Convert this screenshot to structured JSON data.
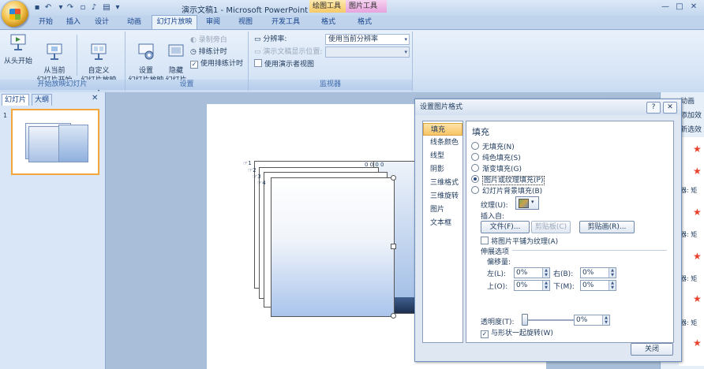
{
  "window": {
    "title": "演示文稿1 - Microsoft PowerPoint",
    "context_tabs": [
      "绘图工具",
      "图片工具"
    ],
    "controls": [
      "—",
      "□",
      "✕"
    ]
  },
  "ribbon_tabs": [
    "开始",
    "插入",
    "设计",
    "动画",
    "幻灯片放映",
    "审阅",
    "视图",
    "开发工具",
    "格式",
    "格式"
  ],
  "active_tab": "幻灯片放映",
  "ribbon": {
    "group_start": {
      "label": "开始放映幻灯片",
      "btn_from_start": "从头开始",
      "btn_from_current": "从当前\n幻灯片开始",
      "btn_custom": "自定义\n幻灯片放映 ▾"
    },
    "group_setup": {
      "label": "设置",
      "btn_setup": "设置\n幻灯片放映",
      "btn_hide": "隐藏\n幻灯片",
      "record_narration": "录制旁白",
      "rehearse_timings": "排练计时",
      "use_timings": "使用排练计时"
    },
    "group_monitors": {
      "label": "监视器",
      "resolution_label": "分辨率:",
      "resolution_value": "使用当前分辨率",
      "show_on_label": "演示文稿显示位置:",
      "show_on_value": "",
      "presenter_view": "使用演示者视图"
    }
  },
  "left_panel": {
    "tabs": [
      "幻灯片",
      "大纲"
    ],
    "close": "✕",
    "slide_number": "1"
  },
  "dialog": {
    "title": "设置图片格式",
    "help": "?",
    "close": "✕",
    "nav": [
      "填充",
      "线条颜色",
      "线型",
      "阴影",
      "三维格式",
      "三维旋转",
      "图片",
      "文本框"
    ],
    "selected_nav": "填充",
    "section_title": "填充",
    "fill_options": [
      "无填充(N)",
      "纯色填充(S)",
      "渐变填充(G)",
      "图片或纹理填充(P)",
      "幻灯片背景填充(B)"
    ],
    "selected_fill": "图片或纹理填充(P)",
    "texture_label": "纹理(U):",
    "insert_from_label": "插入自:",
    "btn_file": "文件(F)...",
    "btn_clipboard": "剪贴板(C)",
    "btn_clipart": "剪贴画(R)...",
    "tile_label": "将图片平铺为纹理(A)",
    "stretch_label": "伸展选项",
    "offset_label": "偏移量:",
    "left_label": "左(L):",
    "left_value": "0%",
    "right_label": "右(B):",
    "right_value": "0%",
    "top_label": "上(O):",
    "top_value": "0%",
    "bottom_label": "下(M):",
    "bottom_value": "0%",
    "transparency_label": "透明度(T):",
    "transparency_value": "0%",
    "rotate_label": "与形状一起旋转(W)",
    "btn_close": "关闭"
  },
  "task_pane": {
    "header": "动画",
    "add_effect": "添加效",
    "modify": "新选效",
    "row_text": "器: 矩"
  },
  "colors": {
    "ribbon_accent": "#15428b",
    "selection": "#f8c566",
    "star": "#e8432e"
  }
}
